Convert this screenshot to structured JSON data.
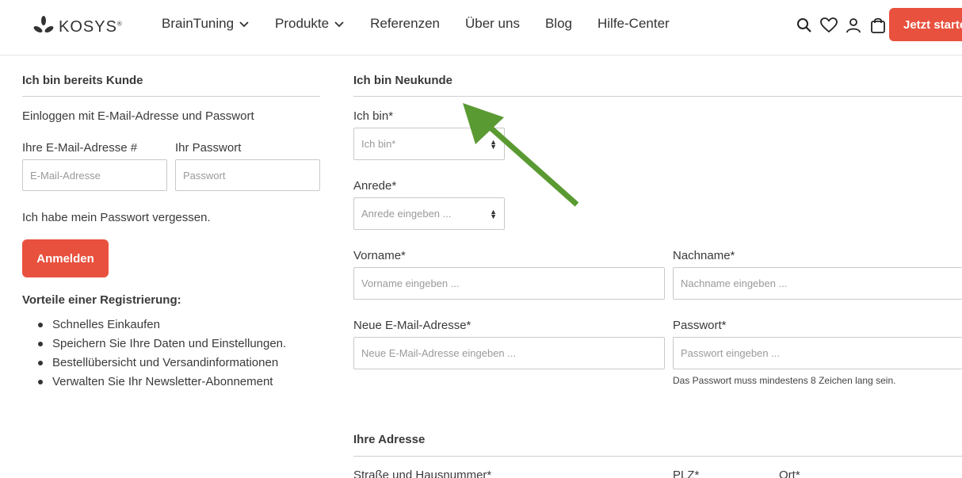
{
  "header": {
    "logo_text": "KOSYS",
    "logo_reg": "®",
    "nav": [
      {
        "label": "BrainTuning"
      },
      {
        "label": "Produkte"
      },
      {
        "label": "Referenzen"
      },
      {
        "label": "Über uns"
      },
      {
        "label": "Blog"
      },
      {
        "label": "Hilfe-Center"
      }
    ],
    "cta_label": "Jetzt starten"
  },
  "login": {
    "heading": "Ich bin bereits Kunde",
    "intro": "Einloggen mit E-Mail-Adresse und Passwort",
    "email_label": "Ihre E-Mail-Adresse #",
    "email_placeholder": "E-Mail-Adresse",
    "password_label": "Ihr Passwort",
    "password_placeholder": "Passwort",
    "forgot": "Ich habe mein Passwort vergessen.",
    "submit": "Anmelden",
    "benefits_heading": "Vorteile einer Registrierung:",
    "benefits": [
      "Schnelles Einkaufen",
      "Speichern Sie Ihre Daten und Einstellungen.",
      "Bestellübersicht und Versandinformationen",
      "Verwalten Sie Ihr Newsletter-Abonnement"
    ]
  },
  "register": {
    "heading": "Ich bin Neukunde",
    "type_label": "Ich bin*",
    "type_placeholder": "Ich bin*",
    "salutation_label": "Anrede*",
    "salutation_placeholder": "Anrede eingeben ...",
    "firstname_label": "Vorname*",
    "firstname_placeholder": "Vorname eingeben ...",
    "lastname_label": "Nachname*",
    "lastname_placeholder": "Nachname eingeben ...",
    "email_label": "Neue E-Mail-Adresse*",
    "email_placeholder": "Neue E-Mail-Adresse eingeben ...",
    "password_label": "Passwort*",
    "password_placeholder": "Passwort eingeben ...",
    "password_hint": "Das Passwort muss mindestens 8 Zeichen lang sein.",
    "address_heading": "Ihre Adresse",
    "street_label": "Straße und Hausnummer*",
    "zip_label": "PLZ*",
    "city_label": "Ort*"
  },
  "colors": {
    "accent": "#e8513e",
    "annotation_arrow": "#5a9a32"
  }
}
